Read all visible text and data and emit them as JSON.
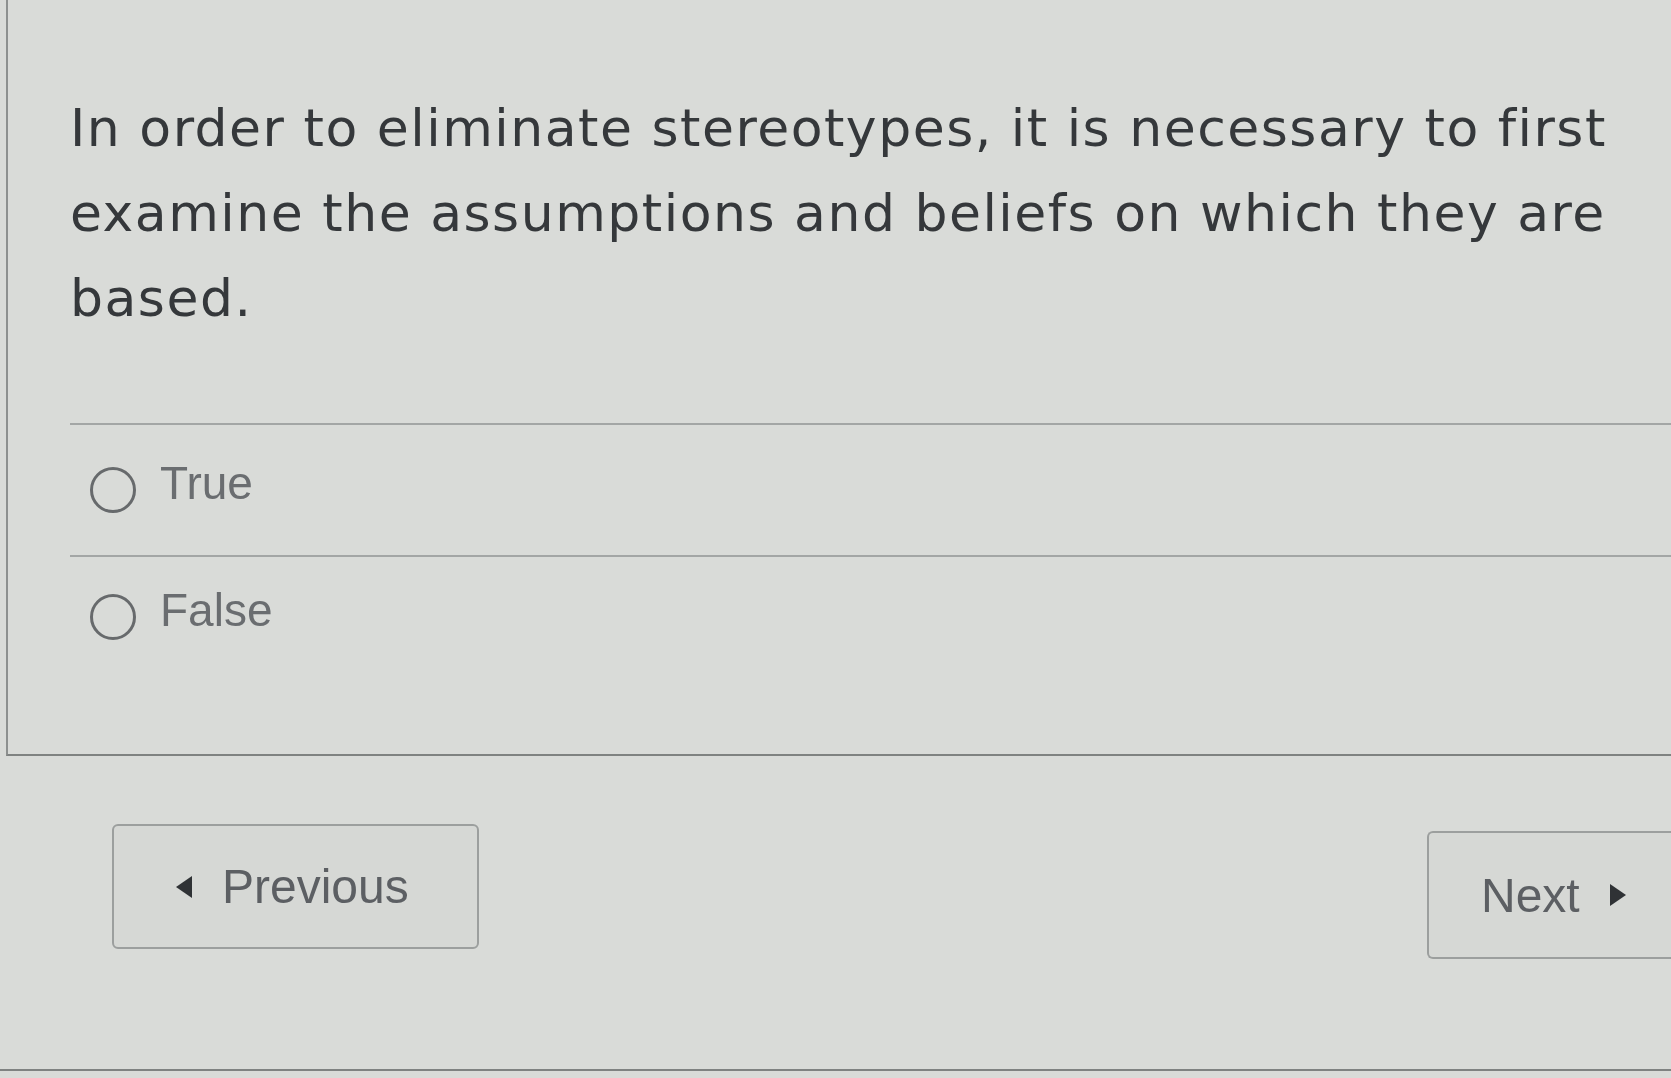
{
  "question": {
    "text": "In order to eliminate stereotypes, it is necessary to first examine the assumptions and beliefs on which they are based."
  },
  "options": [
    {
      "label": "True",
      "selected": false
    },
    {
      "label": "False",
      "selected": false
    }
  ],
  "navigation": [
    {
      "label": "Previous",
      "kind": "previous"
    },
    {
      "label": "Next",
      "kind": "next"
    }
  ]
}
